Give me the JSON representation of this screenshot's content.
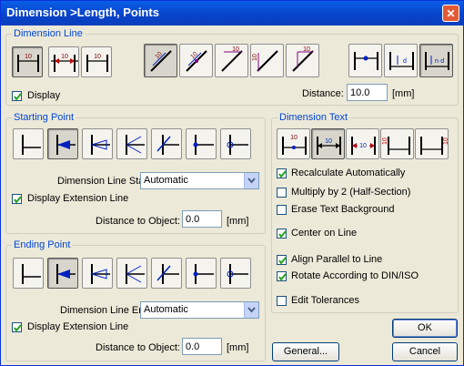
{
  "window": {
    "title": "Dimension >Length, Points",
    "close_symbol": "✕"
  },
  "dimension_line": {
    "label": "Dimension Line",
    "display_label": "Display",
    "display_checked": true,
    "distance_label": "Distance:",
    "distance_value": "10.0",
    "distance_unit": "[mm]",
    "icon_text": "10",
    "icon_text_alt": "d",
    "icon_text_nd": "n·d"
  },
  "starting_point": {
    "label": "Starting Point",
    "line_start_label": "Dimension Line Start:",
    "line_start_value": "Automatic",
    "ext_line_label": "Display Extension Line",
    "ext_line_checked": true,
    "distance_label": "Distance to Object:",
    "distance_value": "0.0",
    "distance_unit": "[mm]"
  },
  "ending_point": {
    "label": "Ending Point",
    "line_end_label": "Dimension Line End:",
    "line_end_value": "Automatic",
    "ext_line_label": "Display Extension Line",
    "ext_line_checked": true,
    "distance_label": "Distance to Object:",
    "distance_value": "0.0",
    "distance_unit": "[mm]"
  },
  "dimension_text": {
    "label": "Dimension Text",
    "icon_text": "10",
    "options": [
      {
        "label": "Recalculate Automatically",
        "checked": true
      },
      {
        "label": "Multiply by 2 (Half-Section)",
        "checked": false
      },
      {
        "label": "Erase Text Background",
        "checked": false
      },
      {
        "label": "Center on Line",
        "checked": true
      },
      {
        "label": "Align Parallel to Line",
        "checked": true
      },
      {
        "label": "Rotate According to DIN/ISO",
        "checked": true
      },
      {
        "label": "Edit Tolerances",
        "checked": false
      }
    ]
  },
  "buttons": {
    "ok": "OK",
    "general": "General...",
    "cancel": "Cancel"
  },
  "colors": {
    "title_bar": "#0842c8",
    "group_label": "#0046d5",
    "icon_red": "#c00000",
    "icon_blue": "#0020c0",
    "icon_purple": "#800080"
  }
}
